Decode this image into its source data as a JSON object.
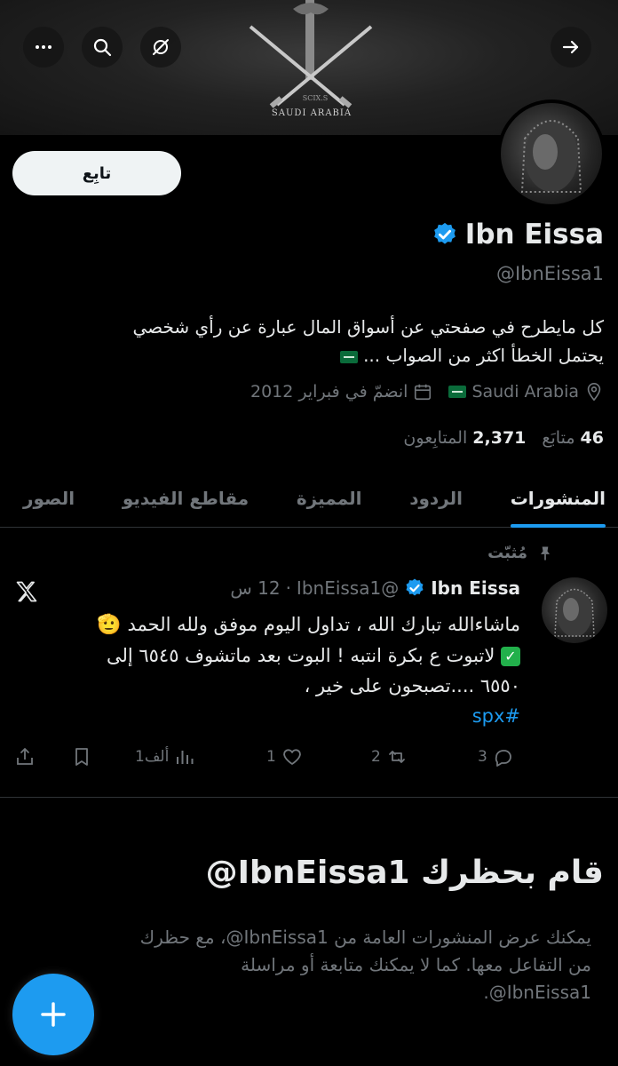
{
  "banner": {
    "small_caption": "SCIX.S",
    "caption": "SAUDI ARABIA"
  },
  "profile": {
    "follow_label": "تابِع",
    "name": "Ibn Eissa",
    "handle": "@IbnEissa1",
    "bio_line1": "كل مايطرح في صفحتي عن أسواق المال عبارة عن رأي شخصي",
    "bio_line2": "يحتمل الخطأ اكثر من الصواب ...",
    "location": "Saudi Arabia",
    "joined": "انضمّ في فبراير 2012",
    "following_count": "46",
    "following_label": "متابَع",
    "followers_count": "2,371",
    "followers_label": "المتابِعون"
  },
  "tabs": [
    {
      "label": "المنشورات",
      "active": true
    },
    {
      "label": "الردود",
      "active": false
    },
    {
      "label": "المميزة",
      "active": false
    },
    {
      "label": "مقاطع الفيديو",
      "active": false
    },
    {
      "label": "الصور",
      "active": false
    }
  ],
  "tweet": {
    "pinned_label": "مُثبّت",
    "name": "Ibn Eissa",
    "handle": "@IbnEissa1",
    "separator": "·",
    "time": "12 س",
    "line1": "ماشاءالله تبارك الله ، تداول اليوم موفق ولله الحمد",
    "line2": "لاتبوت ع بكرة انتبه ! البوت بعد ماتشوف ٦٥٤٥ إلى",
    "line3": "٦٥٥٠ ....تصبحون على خير ،",
    "hashtag": "#spx",
    "replies": "3",
    "reposts": "2",
    "likes": "1",
    "views": "1ألف"
  },
  "blocked": {
    "title": "قام بحظرك IbnEissa1@",
    "line1": "يمكنك عرض المنشورات العامة من IbnEissa1@، مع حظرك",
    "line2": "من التفاعل معها. كما لا يمكنك متابعة أو مراسلة",
    "line3": "IbnEissa1@."
  },
  "icons": {
    "back": "arrow-right-icon",
    "grok": "grok-icon",
    "search": "search-icon",
    "more": "more-icon",
    "verified": "verified-badge-icon",
    "location": "location-pin-icon",
    "calendar": "calendar-icon",
    "pin": "pin-icon",
    "x_logo": "x-logo-icon",
    "compose": "plus-icon"
  },
  "colors": {
    "accent": "#1d9bf0",
    "background": "#000000",
    "text_primary": "#e7e9ea",
    "text_secondary": "#71767b",
    "border": "#2f3336"
  }
}
